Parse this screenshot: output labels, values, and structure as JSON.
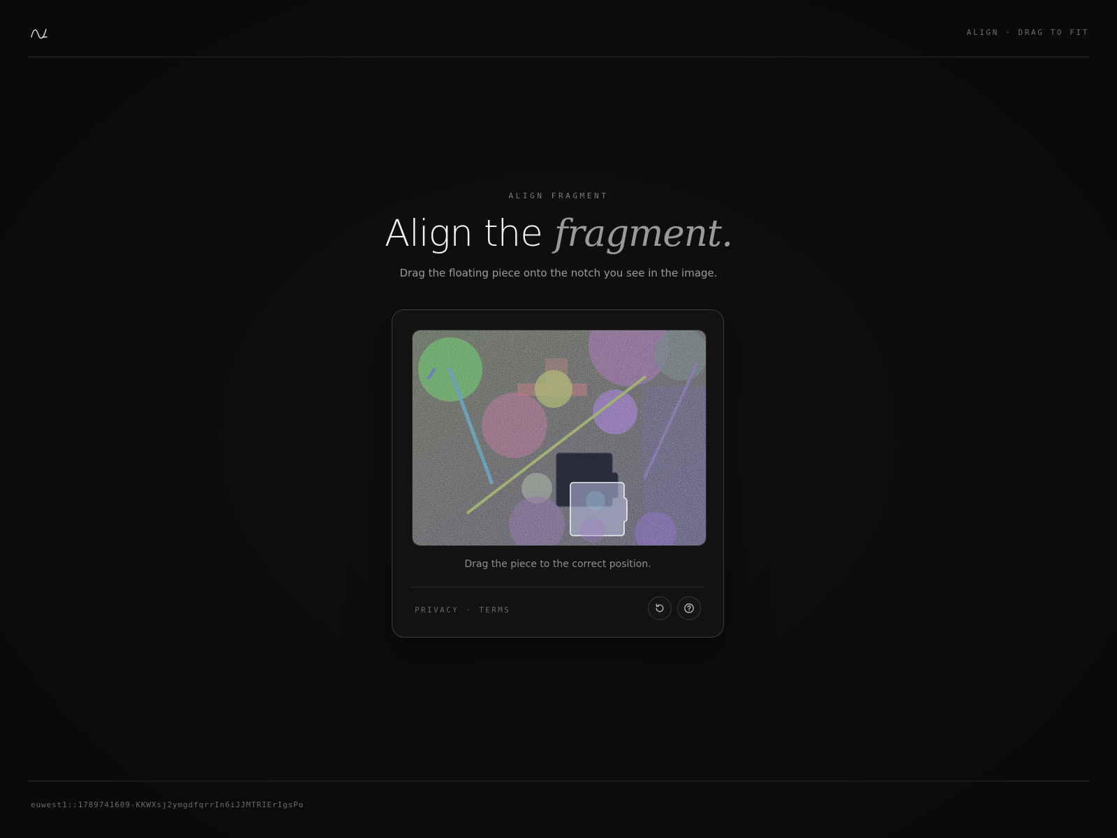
{
  "header": {
    "logo_icon": "wave-logo-icon",
    "status_text": "ALIGN · DRAG TO FIT"
  },
  "main": {
    "eyebrow": "ALIGN FRAGMENT",
    "title_plain": "Align the",
    "title_accent": "fragment.",
    "subtitle": "Drag the floating piece onto the notch you see in the image."
  },
  "widget": {
    "hint": "Drag the piece to the correct position.",
    "footer": {
      "privacy": "PRIVACY",
      "separator": "·",
      "terms": "TERMS"
    },
    "buttons": {
      "refresh_icon": "refresh-icon",
      "help_icon": "help-icon"
    }
  },
  "footer": {
    "session_id": "euwest1::1789741609-KKWXsj2ymgdfqrrIn6iJJMTRIErIgsPo"
  },
  "colors": {
    "background": "#0b0b0b",
    "card": "#121212",
    "accent_text": "#9a9a9a"
  }
}
